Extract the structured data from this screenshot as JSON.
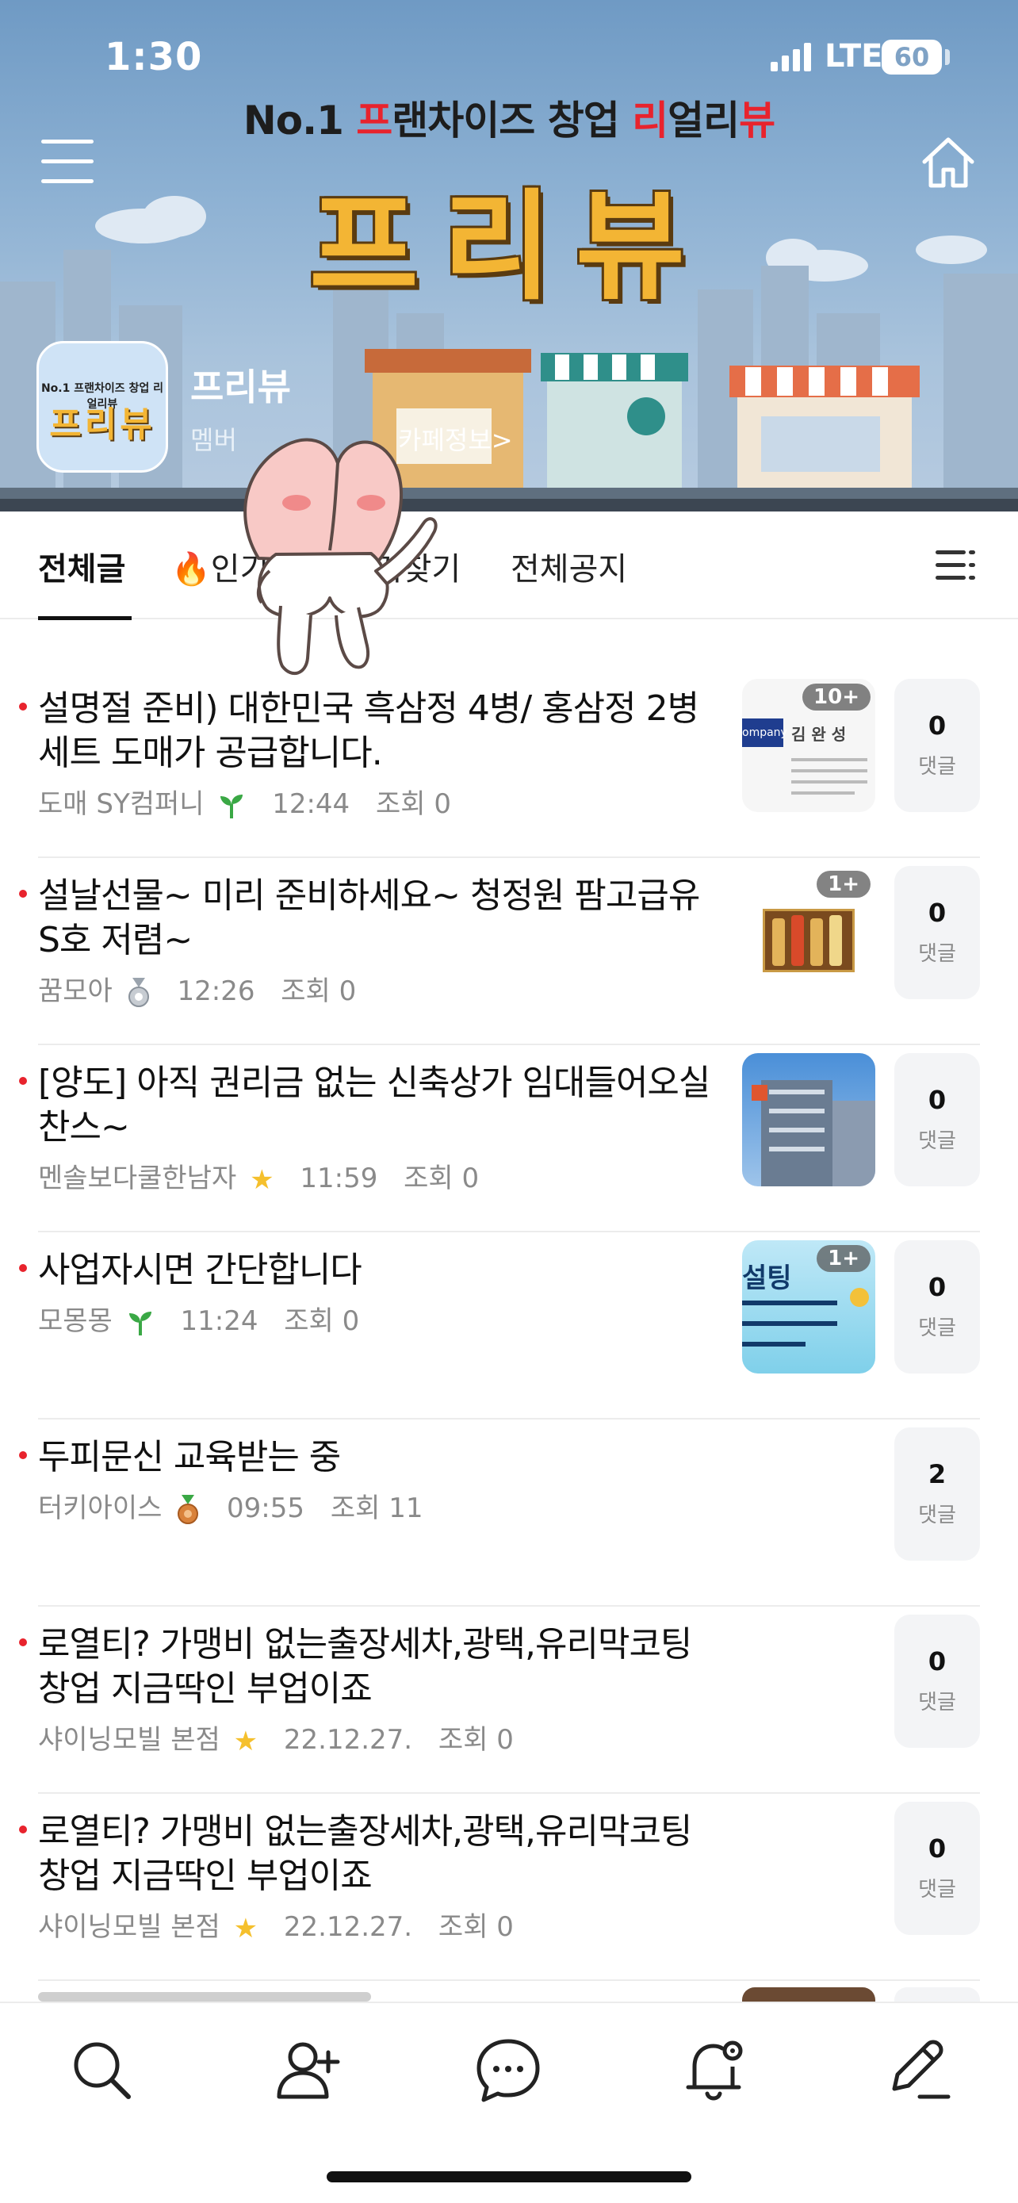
{
  "status_bar": {
    "time": "1:30",
    "network": "LTE",
    "battery": "60"
  },
  "banner": {
    "slogan_prefix": "No.1 ",
    "slogan_r1": "프",
    "slogan_mid": "랜차이즈 창업 ",
    "slogan_r2": "리",
    "slogan_mid2": "얼리",
    "slogan_r3": "뷰",
    "big_title": "프리뷰"
  },
  "cafe": {
    "logo_small": "No.1 프랜차이즈 창업 리얼리뷰",
    "logo_big": "프리뷰",
    "name": "프리뷰",
    "sub": "멤버",
    "info_link": "카페정보>"
  },
  "tabs": [
    {
      "label": "전체글",
      "active": true
    },
    {
      "label": "🔥인기글"
    },
    {
      "label": "즐겨찾기"
    },
    {
      "label": "전체공지"
    }
  ],
  "posts": [
    {
      "title": "설명절 준비) 대한민국 흑삼정 4병/ 홍삼정 2병 세트 도매가 공급합니다.",
      "author": "도매 SY컴퍼니",
      "badge": "sprout-icon",
      "time": "12:44",
      "views_label": "조회 0",
      "thumb_count": "10+",
      "comments": "0",
      "comment_label": "댓글"
    },
    {
      "title": "설날선물~ 미리 준비하세요~ 청정원 팜고급유S호 저렴~",
      "author": "꿈모아",
      "badge": "silver-medal-icon",
      "time": "12:26",
      "views_label": "조회 0",
      "thumb_count": "1+",
      "comments": "0",
      "comment_label": "댓글"
    },
    {
      "title": "[양도] 아직 권리금 없는 신축상가 임대들어오실 찬스~",
      "author": "멘솔보다쿨한남자",
      "badge": "star-icon",
      "time": "11:59",
      "views_label": "조회 0",
      "thumb_count": "",
      "comments": "0",
      "comment_label": "댓글"
    },
    {
      "title": "사업자시면 간단합니다",
      "author": "모몽몽",
      "badge": "sprout-icon",
      "time": "11:24",
      "views_label": "조회 0",
      "thumb_count": "1+",
      "comments": "0",
      "comment_label": "댓글"
    },
    {
      "title": "두피문신 교육받는 중",
      "author": "터키아이스",
      "badge": "bronze-medal-icon",
      "time": "09:55",
      "views_label": "조회 11",
      "thumb_count": "",
      "comments": "2",
      "comment_label": "댓글"
    },
    {
      "title": "로열티? 가맹비 없는출장세차,광택,유리막코팅 창업 지금딱인 부업이죠",
      "author": "샤이닝모빌 본점",
      "badge": "star-icon",
      "time": "22.12.27.",
      "views_label": "조회 0",
      "thumb_count": "",
      "comments": "0",
      "comment_label": "댓글"
    },
    {
      "title": "로열티? 가맹비 없는출장세차,광택,유리막코팅 창업 지금딱인 부업이죠",
      "author": "샤이닝모빌 본점",
      "badge": "star-icon",
      "time": "22.12.27.",
      "views_label": "조회 0",
      "thumb_count": "",
      "comments": "0",
      "comment_label": "댓글"
    }
  ],
  "thumbs": {
    "card_name": "김 완 성",
    "card_company": "ompany",
    "store_label": "설팅"
  },
  "bottom_bar": [
    "search-icon",
    "add-member-icon",
    "chat-icon",
    "notification-settings-icon",
    "write-icon"
  ],
  "colors": {
    "accent_red": "#e8232d",
    "title_yellow": "#f3b534",
    "sky": "#8db1d3"
  }
}
